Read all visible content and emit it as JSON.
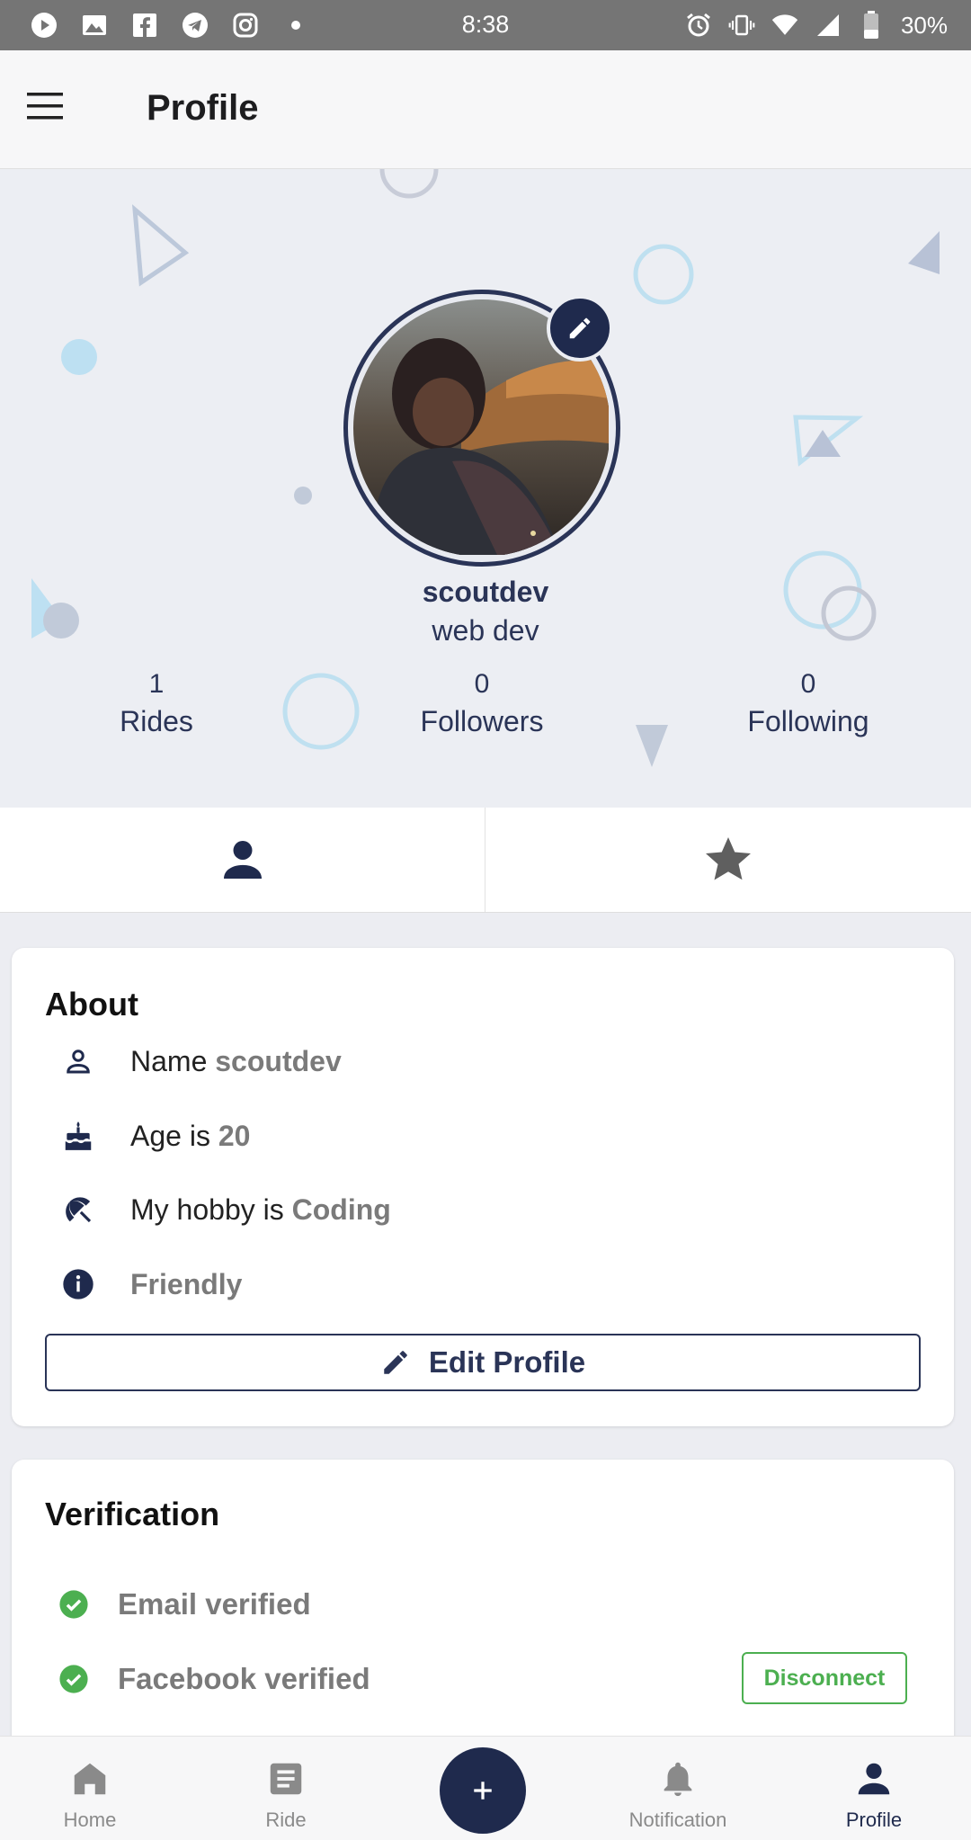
{
  "status_bar": {
    "time": "8:38",
    "battery": "30%",
    "left_icons": [
      "play-icon",
      "image-icon",
      "facebook-icon",
      "telegram-icon",
      "instagram-icon",
      "dot-icon"
    ],
    "right_icons": [
      "alarm-icon",
      "vibrate-icon",
      "wifi-icon",
      "signal-icon",
      "battery-icon"
    ]
  },
  "app_bar": {
    "title": "Profile"
  },
  "profile": {
    "username": "scoutdev",
    "title": "web dev",
    "stats": [
      {
        "value": "1",
        "label": "Rides"
      },
      {
        "value": "0",
        "label": "Followers"
      },
      {
        "value": "0",
        "label": "Following"
      }
    ]
  },
  "tabs": [
    {
      "icon": "person-icon",
      "active": true
    },
    {
      "icon": "star-icon",
      "active": false
    }
  ],
  "about": {
    "title": "About",
    "rows": [
      {
        "icon": "person-outline-icon",
        "label": "Name",
        "value": "scoutdev"
      },
      {
        "icon": "cake-icon",
        "label": "Age is",
        "value": "20"
      },
      {
        "icon": "beach-umbrella-icon",
        "label": "My hobby is",
        "value": "Coding"
      },
      {
        "icon": "info-icon",
        "label": "",
        "value": "Friendly"
      }
    ],
    "edit_button": "Edit Profile"
  },
  "verification": {
    "title": "Verification",
    "items": [
      {
        "label": "Email verified",
        "status": "verified"
      },
      {
        "label": "Facebook verified",
        "status": "verified",
        "action": "Disconnect"
      }
    ]
  },
  "bottom_nav": {
    "items": [
      {
        "label": "Home",
        "icon": "home-icon",
        "active": false
      },
      {
        "label": "Ride",
        "icon": "ride-icon",
        "active": false
      },
      {
        "label": "Notification",
        "icon": "bell-icon",
        "active": false
      },
      {
        "label": "Profile",
        "icon": "person-icon",
        "active": true
      }
    ],
    "fab_icon": "plus-icon"
  },
  "colors": {
    "primary": "#1f2a4d",
    "success": "#4caf50",
    "header_bg": "#eceef3",
    "status_bar": "#757575"
  }
}
